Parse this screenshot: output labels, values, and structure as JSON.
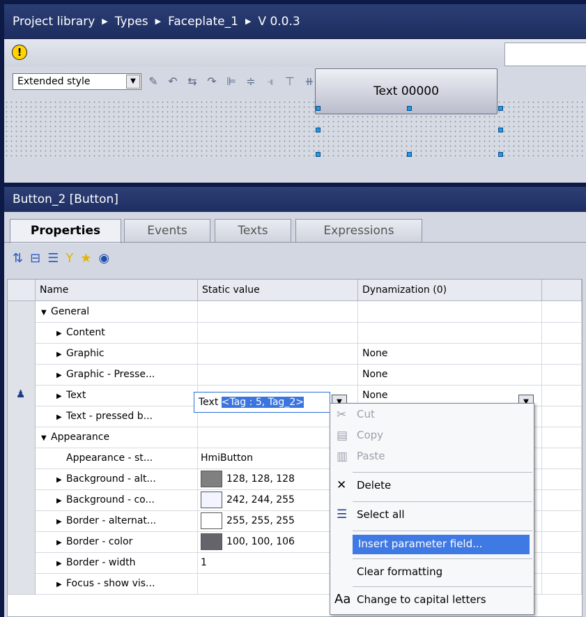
{
  "breadcrumb": {
    "items": [
      "Project library",
      "Types",
      "Faceplate_1",
      "V 0.0.3"
    ]
  },
  "editor": {
    "style_select": "Extended style",
    "preview_button_text": "Text 00000"
  },
  "inspector": {
    "title": "Button_2 [Button]",
    "tabs": [
      "Properties",
      "Events",
      "Texts",
      "Expressions"
    ],
    "active_tab": "Properties"
  },
  "grid": {
    "headers": [
      "Name",
      "Static value",
      "Dynamization (0)"
    ],
    "rows": [
      {
        "name": "General",
        "expand": "▼",
        "indent": 0,
        "value": "",
        "dyn": ""
      },
      {
        "name": "Content",
        "expand": "▶",
        "indent": 1,
        "value": "",
        "dyn": ""
      },
      {
        "name": "Graphic",
        "expand": "▶",
        "indent": 1,
        "value": "",
        "dyn": "None"
      },
      {
        "name": "Graphic - Presse...",
        "expand": "▶",
        "indent": 1,
        "value": "",
        "dyn": "None"
      },
      {
        "name": "Text",
        "expand": "▶",
        "indent": 1,
        "value": "",
        "dyn": "None"
      },
      {
        "name": "Text - pressed b...",
        "expand": "▶",
        "indent": 1,
        "value": "",
        "dyn": ""
      },
      {
        "name": "Appearance",
        "expand": "▼",
        "indent": 0,
        "value": "",
        "dyn": ""
      },
      {
        "name": "Appearance - st...",
        "expand": "",
        "indent": 1,
        "value": "HmiButton",
        "dyn": ""
      },
      {
        "name": "Background - alt...",
        "expand": "▶",
        "indent": 1,
        "value": "128, 128, 128",
        "swatch": "#808080",
        "dyn": ""
      },
      {
        "name": "Background - co...",
        "expand": "▶",
        "indent": 1,
        "value": "242, 244, 255",
        "swatch": "#f2f4ff",
        "dyn": ""
      },
      {
        "name": "Border - alternat...",
        "expand": "▶",
        "indent": 1,
        "value": "255, 255, 255",
        "swatch": "#ffffff",
        "dyn": ""
      },
      {
        "name": "Border - color",
        "expand": "▶",
        "indent": 1,
        "value": "100, 100, 106",
        "swatch": "#64646a",
        "dyn": ""
      },
      {
        "name": "Border - width",
        "expand": "▶",
        "indent": 1,
        "value": "1",
        "dyn": ""
      },
      {
        "name": "Focus - show vis...",
        "expand": "▶",
        "indent": 1,
        "value": "",
        "dyn": ""
      }
    ],
    "text_edit": {
      "prefix": "Text ",
      "selected": "<Tag : 5, Tag_2>"
    }
  },
  "context_menu": {
    "items": [
      {
        "label": "Cut",
        "icon": "cut-icon",
        "glyph": "✂",
        "disabled": true
      },
      {
        "label": "Copy",
        "icon": "copy-icon",
        "glyph": "▤",
        "disabled": true
      },
      {
        "label": "Paste",
        "icon": "paste-icon",
        "glyph": "▥",
        "disabled": true
      },
      {
        "label": "Delete",
        "icon": "delete-icon",
        "glyph": "✕",
        "disabled": false
      },
      {
        "label": "Select all",
        "icon": "select-all-icon",
        "glyph": "☰",
        "disabled": false
      },
      {
        "label": "Insert parameter field...",
        "icon": "",
        "glyph": "",
        "disabled": false,
        "highlighted": true
      },
      {
        "label": "Clear formatting",
        "icon": "",
        "glyph": "",
        "disabled": false
      },
      {
        "label": "Change to capital letters",
        "icon": "capital-letters-icon",
        "glyph": "Aa",
        "disabled": false
      }
    ]
  },
  "colors": {
    "accent": "#3f79e4",
    "title_bar": "#1e2e62",
    "warning": "#ffd400"
  }
}
